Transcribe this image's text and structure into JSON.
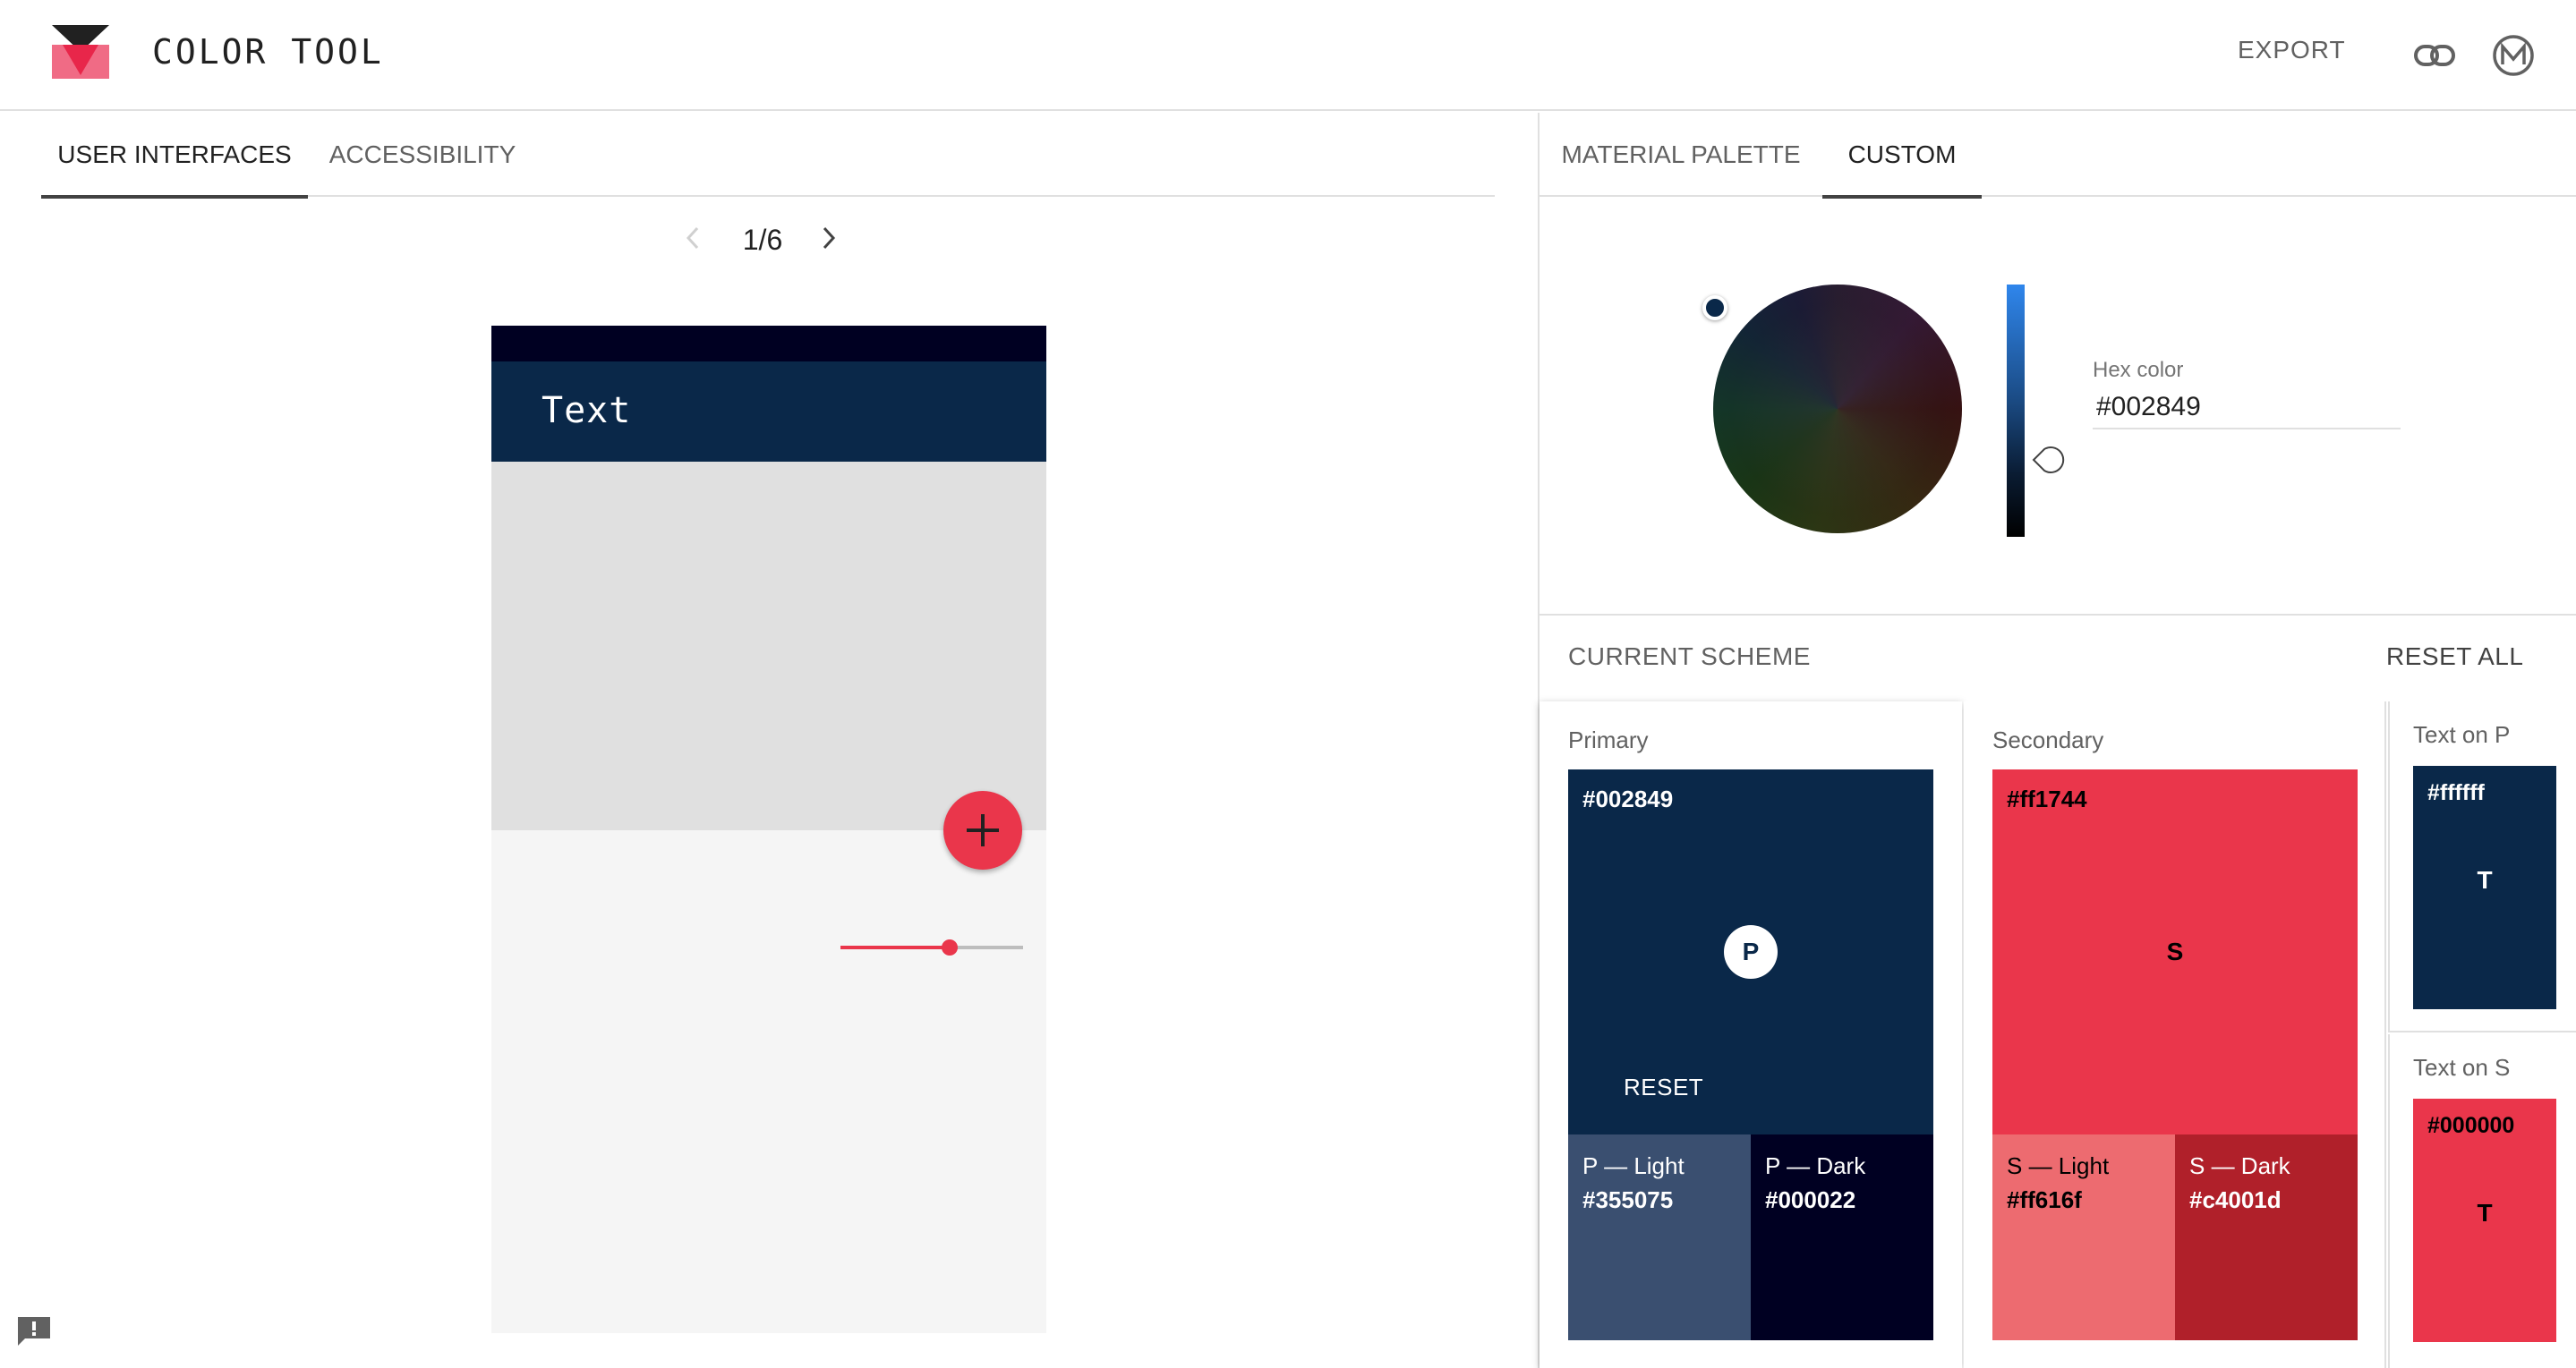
{
  "header": {
    "app_title": "COLOR TOOL",
    "export_label": "EXPORT",
    "icons": [
      "logo",
      "link-icon",
      "material-m-icon"
    ]
  },
  "left": {
    "tabs": [
      {
        "label": "USER INTERFACES",
        "active": true
      },
      {
        "label": "ACCESSIBILITY",
        "active": false
      }
    ],
    "pager": {
      "label": "1/6",
      "current": 1,
      "total": 6
    },
    "phone": {
      "appbar_title": "Text",
      "fab_icon": "plus-icon",
      "slider_value": 0.6
    }
  },
  "right": {
    "tabs": [
      {
        "label": "MATERIAL PALETTE",
        "active": false
      },
      {
        "label": "CUSTOM",
        "active": true
      }
    ],
    "picker": {
      "hex_label": "Hex color",
      "hex_value": "#002849"
    },
    "scheme": {
      "title": "CURRENT SCHEME",
      "reset_all": "RESET ALL",
      "primary": {
        "label": "Primary",
        "hex": "#002849",
        "letter": "P",
        "reset": "RESET",
        "light_name": "P — Light",
        "light_hex": "#355075",
        "dark_name": "P — Dark",
        "dark_hex": "#000022"
      },
      "secondary": {
        "label": "Secondary",
        "hex": "#ff1744",
        "letter": "S",
        "light_name": "S — Light",
        "light_hex": "#ff616f",
        "dark_name": "S — Dark",
        "dark_hex": "#c4001d"
      },
      "text_on_p": {
        "label": "Text on P",
        "hex": "#ffffff",
        "letter": "T"
      },
      "text_on_s": {
        "label": "Text on S",
        "hex": "#000000",
        "letter": "T"
      }
    }
  },
  "colors": {
    "primary": "#0a2849",
    "primary_light": "#3a4f70",
    "primary_dark": "#000022",
    "secondary": "#ea364b",
    "secondary_light": "#ed6b70",
    "secondary_dark": "#b0202a",
    "accent": "#ea364b"
  }
}
